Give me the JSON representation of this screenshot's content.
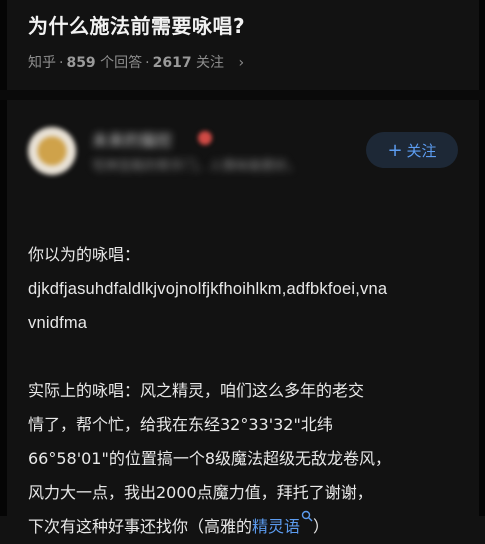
{
  "question": {
    "title": "为什么施法前需要咏唱?",
    "source": "知乎",
    "answers_count": "859",
    "answers_label": "个回答",
    "followers_count": "2617",
    "followers_label": "关注",
    "chevron": "›"
  },
  "author": {
    "name": "未来的猫控",
    "bio": "宅神圣殿的帮手门，人情味做更好。",
    "follow_plus": "+",
    "follow_label": "关注"
  },
  "answer": {
    "line1": "你以为的咏唱：",
    "line2": "djkdfjasuhdfaldlkjvojnolfjkfhoihlkm,adfbkfoei,vna",
    "line3": "vnidfma",
    "line4": "实际上的咏唱：风之精灵，咱们这么多年的老交",
    "line5": "情了，帮个忙，给我在东经32°33'32\"北纬",
    "line6": "66°58'01\"的位置搞一个8级魔法超级无敌龙卷风，",
    "line7": "风力大一点，我出2000点魔力值，拜托了谢谢，",
    "line8_prefix": "下次有这种好事还找你（高雅的",
    "line8_link": "精灵语",
    "line8_suffix": "）"
  },
  "colors": {
    "background": "#121212",
    "link": "#5c9cf0",
    "follow_bg": "#1d2836"
  }
}
